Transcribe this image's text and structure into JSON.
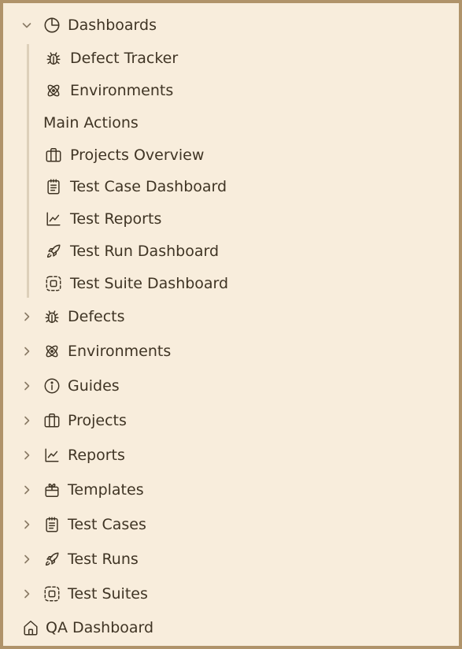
{
  "nav": {
    "dashboards": {
      "label": "Dashboards",
      "children": [
        {
          "label": "Defect Tracker",
          "icon": "bug-icon"
        },
        {
          "label": "Environments",
          "icon": "atom-icon"
        },
        {
          "label": "Main Actions",
          "icon": ""
        },
        {
          "label": "Projects Overview",
          "icon": "briefcase-icon"
        },
        {
          "label": "Test Case Dashboard",
          "icon": "clipboard-icon"
        },
        {
          "label": "Test Reports",
          "icon": "chart-line-icon"
        },
        {
          "label": "Test Run Dashboard",
          "icon": "rocket-icon"
        },
        {
          "label": "Test Suite Dashboard",
          "icon": "dashed-square-icon"
        }
      ]
    },
    "groups": [
      {
        "label": "Defects",
        "icon": "bug-icon"
      },
      {
        "label": "Environments",
        "icon": "atom-icon"
      },
      {
        "label": "Guides",
        "icon": "info-icon"
      },
      {
        "label": "Projects",
        "icon": "briefcase-icon"
      },
      {
        "label": "Reports",
        "icon": "chart-line-icon"
      },
      {
        "label": "Templates",
        "icon": "gift-box-icon"
      },
      {
        "label": "Test Cases",
        "icon": "clipboard-icon"
      },
      {
        "label": "Test Runs",
        "icon": "rocket-icon"
      },
      {
        "label": "Test Suites",
        "icon": "dashed-square-icon"
      }
    ],
    "home": {
      "label": "QA Dashboard",
      "icon": "home-icon"
    }
  },
  "colors": {
    "background": "#f8eddc",
    "border": "#b0936a",
    "text": "#3f3424",
    "chevron": "#8a7a65",
    "guide_line": "#ddd0ba"
  }
}
